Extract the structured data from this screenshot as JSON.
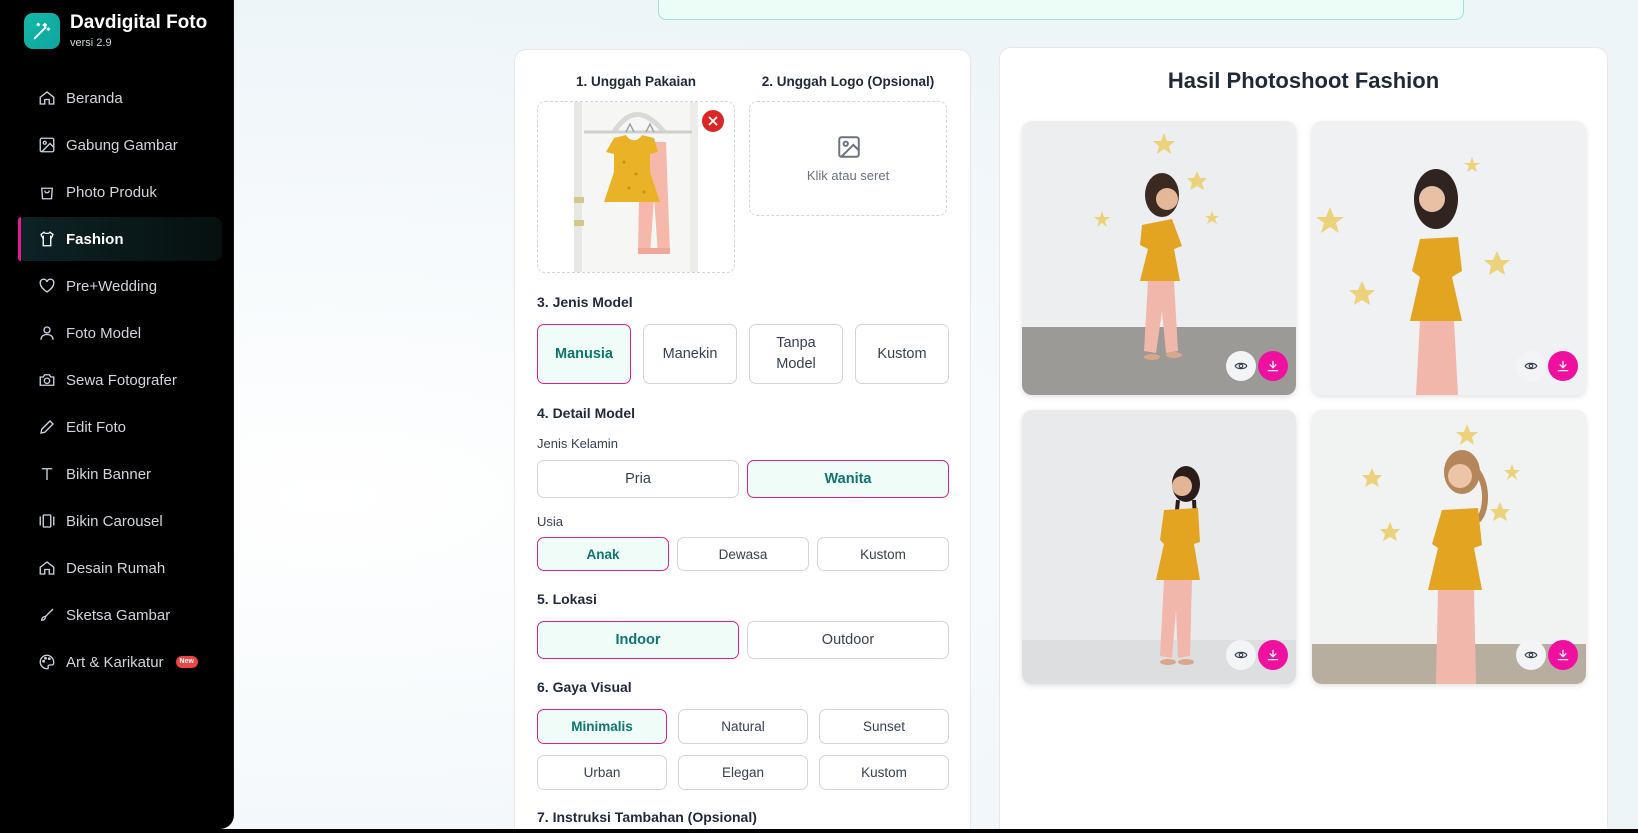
{
  "app": {
    "name": "Davdigital Foto",
    "version": "versi 2.9"
  },
  "sidebar": {
    "items": [
      {
        "label": "Beranda",
        "icon": "home-icon"
      },
      {
        "label": "Gabung Gambar",
        "icon": "image-icon"
      },
      {
        "label": "Photo Produk",
        "icon": "shopping-bag-icon"
      },
      {
        "label": "Fashion",
        "icon": "shirt-icon",
        "active": true
      },
      {
        "label": "Pre+Wedding",
        "icon": "heart-icon"
      },
      {
        "label": "Foto Model",
        "icon": "user-icon"
      },
      {
        "label": "Sewa Fotografer",
        "icon": "camera-icon"
      },
      {
        "label": "Edit Foto",
        "icon": "pencil-icon"
      },
      {
        "label": "Bikin Banner",
        "icon": "type-icon"
      },
      {
        "label": "Bikin Carousel",
        "icon": "carousel-icon"
      },
      {
        "label": "Desain Rumah",
        "icon": "home-icon"
      },
      {
        "label": "Sketsa Gambar",
        "icon": "brush-icon"
      },
      {
        "label": "Art & Karikatur",
        "icon": "palette-icon",
        "badge": "New"
      }
    ]
  },
  "form": {
    "upload_clothing_label": "1. Unggah Pakaian",
    "upload_logo_label": "2. Unggah Logo (Opsional)",
    "upload_logo_hint": "Klik atau seret",
    "model_type": {
      "title": "3. Jenis Model",
      "options": [
        "Manusia",
        "Manekin",
        "Tanpa Model",
        "Kustom"
      ],
      "selected": "Manusia"
    },
    "model_detail": {
      "title": "4. Detail Model",
      "gender_label": "Jenis Kelamin",
      "gender_options": [
        "Pria",
        "Wanita"
      ],
      "gender_selected": "Wanita",
      "age_label": "Usia",
      "age_options": [
        "Anak",
        "Dewasa",
        "Kustom"
      ],
      "age_selected": "Anak"
    },
    "location": {
      "title": "5. Lokasi",
      "options": [
        "Indoor",
        "Outdoor"
      ],
      "selected": "Indoor"
    },
    "visual_style": {
      "title": "6. Gaya Visual",
      "options": [
        "Minimalis",
        "Natural",
        "Sunset",
        "Urban",
        "Elegan",
        "Kustom"
      ],
      "selected": "Minimalis"
    },
    "extra_instructions_title": "7. Instruksi Tambahan (Opsional)"
  },
  "results": {
    "title": "Hasil Photoshoot Fashion",
    "count": 4
  },
  "colors": {
    "accent": "#e11d8f",
    "selected_bg": "#effcf8",
    "selected_text": "#0f766e",
    "download": "#f0109f",
    "brand": "#14b8a6"
  }
}
